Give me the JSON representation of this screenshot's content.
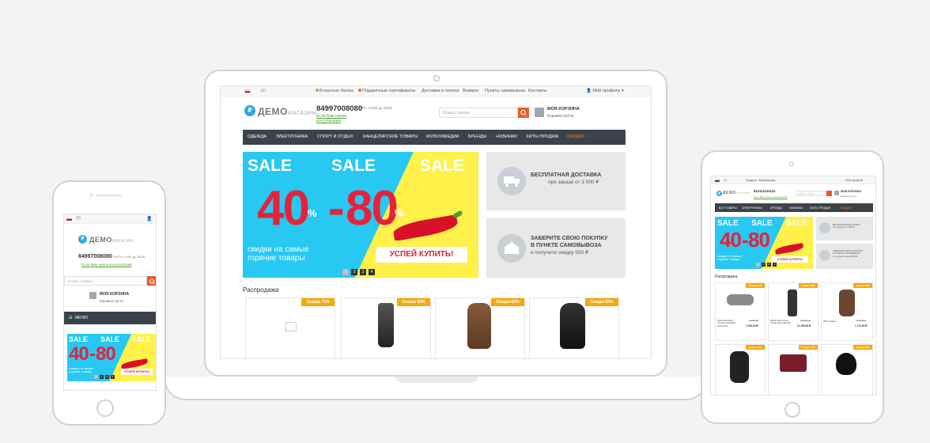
{
  "top_bar": {
    "currency": "(₽)",
    "links": [
      "Бонусные баллы",
      "Подарочные сертификаты",
      "Доставка и оплата",
      "Возврат",
      "Пункты самовывоза",
      "Контакты"
    ],
    "profile": "Мой профиль"
  },
  "logo": {
    "main": "ДЕМО",
    "sub": "МАГАЗИН"
  },
  "header": {
    "phone": "84997008080",
    "hours": "Пн-Пт с 9:00 до 18:00",
    "callback": "Если Вам нужна консультация",
    "search_placeholder": "Искать товары",
    "cart_title": "МОЯ КОРЗИНА",
    "cart_status": "Корзина пуста"
  },
  "nav_items": [
    "ОДЕЖДА",
    "ЭЛЕКТРОНИКА",
    "СПОРТ И ОТДЫХ",
    "КАНЦЕЛЯРСКИЕ ТОВАРЫ",
    "МУЛЬТИМЕДИА",
    "БРЕНДЫ",
    "НОВИНКИ",
    "ХИТЫ ПРОДАЖ",
    "СКИДКИ"
  ],
  "banner": {
    "sale": "SALE",
    "range_from": "40",
    "range_to": "80",
    "percent": "%",
    "tagline_1": "скидки на самые",
    "tagline_2": "горячие товары",
    "cta": "УСПЕЙ КУПИТЬ!",
    "pages": [
      "1",
      "2",
      "3",
      "4"
    ]
  },
  "promos": [
    {
      "title": "БЕСПЛАТНАЯ ДОСТАВКА",
      "text": "при заказе от 3 000 ₽"
    },
    {
      "title": "ЗАБЕРИТЕ СВОЮ ПОКУПКУ",
      "title2": "В ПУНКТЕ САМОВЫВОЗА",
      "text": "и получите скидку 500 ₽"
    }
  ],
  "section_title": "Распродажа",
  "badges": [
    "Скидка 71%",
    "Скидка 63%",
    "Скидка 63%",
    "Скидка 62%"
  ],
  "phone_view": {
    "menu_label": "МЕНЮ",
    "callback": "Если Вам нужна консультация"
  },
  "tablet_view": {
    "links": [
      "Подарки",
      "Информация"
    ],
    "phone": "811111111111",
    "nav_items": [
      "ВСЕ ТОВАРЫ",
      "ЭЛЕКТРОНИКА",
      "БРЕНДЫ",
      "НОВИНКИ",
      "ХИТЫ ПРОДАЖ",
      "СКИДКИ"
    ],
    "badges": [
      "Скидка 57%",
      "Скидка 63%",
      "Скидка 63%",
      "Скидка 63%",
      "Скидка 57%",
      "Скидка 63%"
    ],
    "products": [
      {
        "name": "Электрический степлер Swingline Optima 20",
        "old": "3 646,33 ₽",
        "price": "1 526,29 ₽"
      },
      {
        "name": "Набор для игры в гольф (для левшей)",
        "old": "31 050,00 ₽",
        "price": "11 499,65 ₽"
      },
      {
        "name": "2011 Трекинг",
        "old": "3 645,00 ₽",
        "price": "1 275,00 ₽"
      }
    ]
  },
  "colors": {
    "accent": "#f0592a",
    "nav": "#3b424a",
    "brand": "#2fa8e0",
    "badge": "#f6a90c"
  }
}
